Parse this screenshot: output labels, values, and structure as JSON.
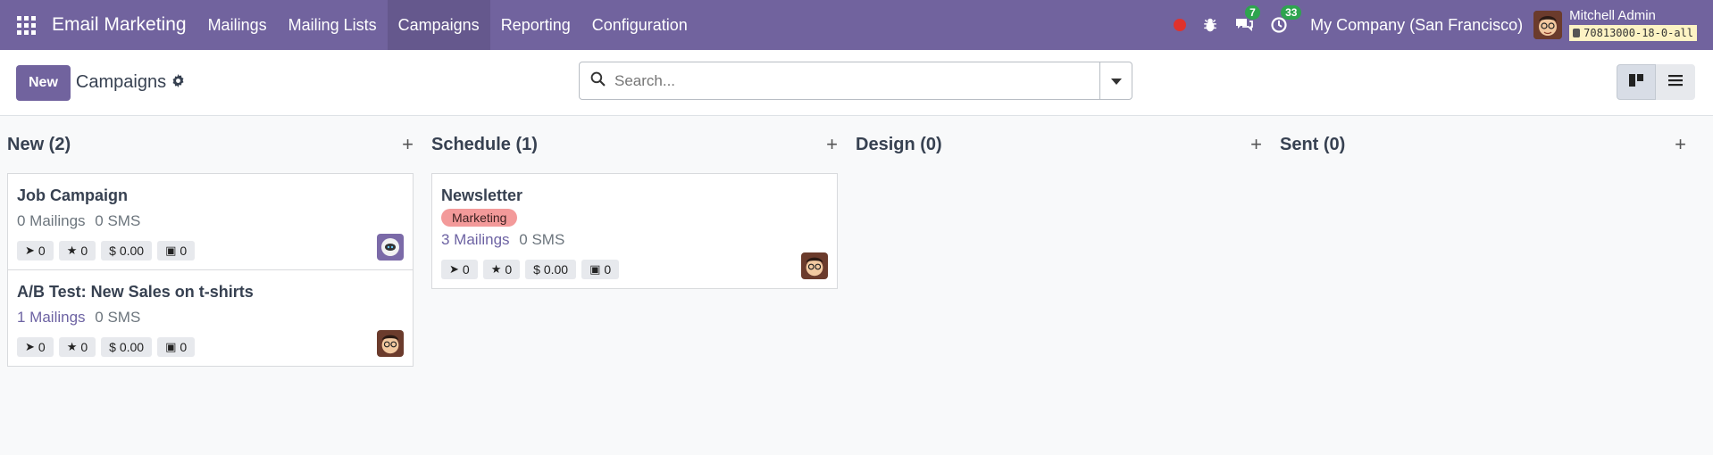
{
  "navbar": {
    "app_title": "Email Marketing",
    "menu": [
      {
        "label": "Mailings",
        "active": false
      },
      {
        "label": "Mailing Lists",
        "active": false
      },
      {
        "label": "Campaigns",
        "active": true
      },
      {
        "label": "Reporting",
        "active": false
      },
      {
        "label": "Configuration",
        "active": false
      }
    ],
    "messages_count": "7",
    "activities_count": "33",
    "company": "My Company (San Francisco)",
    "user_name": "Mitchell Admin",
    "db_name": "70813000-18-0-all",
    "accent": "#71639e"
  },
  "control": {
    "new_label": "New",
    "breadcrumb": "Campaigns",
    "search_placeholder": "Search..."
  },
  "columns": [
    {
      "title": "New (2)",
      "cards": [
        {
          "title": "Job Campaign",
          "tag": "",
          "mailings": "0 Mailings",
          "sms": "0 SMS",
          "clicks": "0",
          "stars": "0",
          "revenue": "$ 0.00",
          "money": "0",
          "avatar": "robot"
        },
        {
          "title": "A/B Test: New Sales on t-shirts",
          "tag": "",
          "mailings": "1 Mailings",
          "sms": "0 SMS",
          "clicks": "0",
          "stars": "0",
          "revenue": "$ 0.00",
          "money": "0",
          "avatar": "admin"
        }
      ]
    },
    {
      "title": "Schedule (1)",
      "cards": [
        {
          "title": "Newsletter",
          "tag": "Marketing",
          "mailings": "3 Mailings",
          "sms": "0 SMS",
          "clicks": "0",
          "stars": "0",
          "revenue": "$ 0.00",
          "money": "0",
          "avatar": "admin"
        }
      ]
    },
    {
      "title": "Design (0)",
      "cards": []
    },
    {
      "title": "Sent (0)",
      "cards": []
    }
  ]
}
